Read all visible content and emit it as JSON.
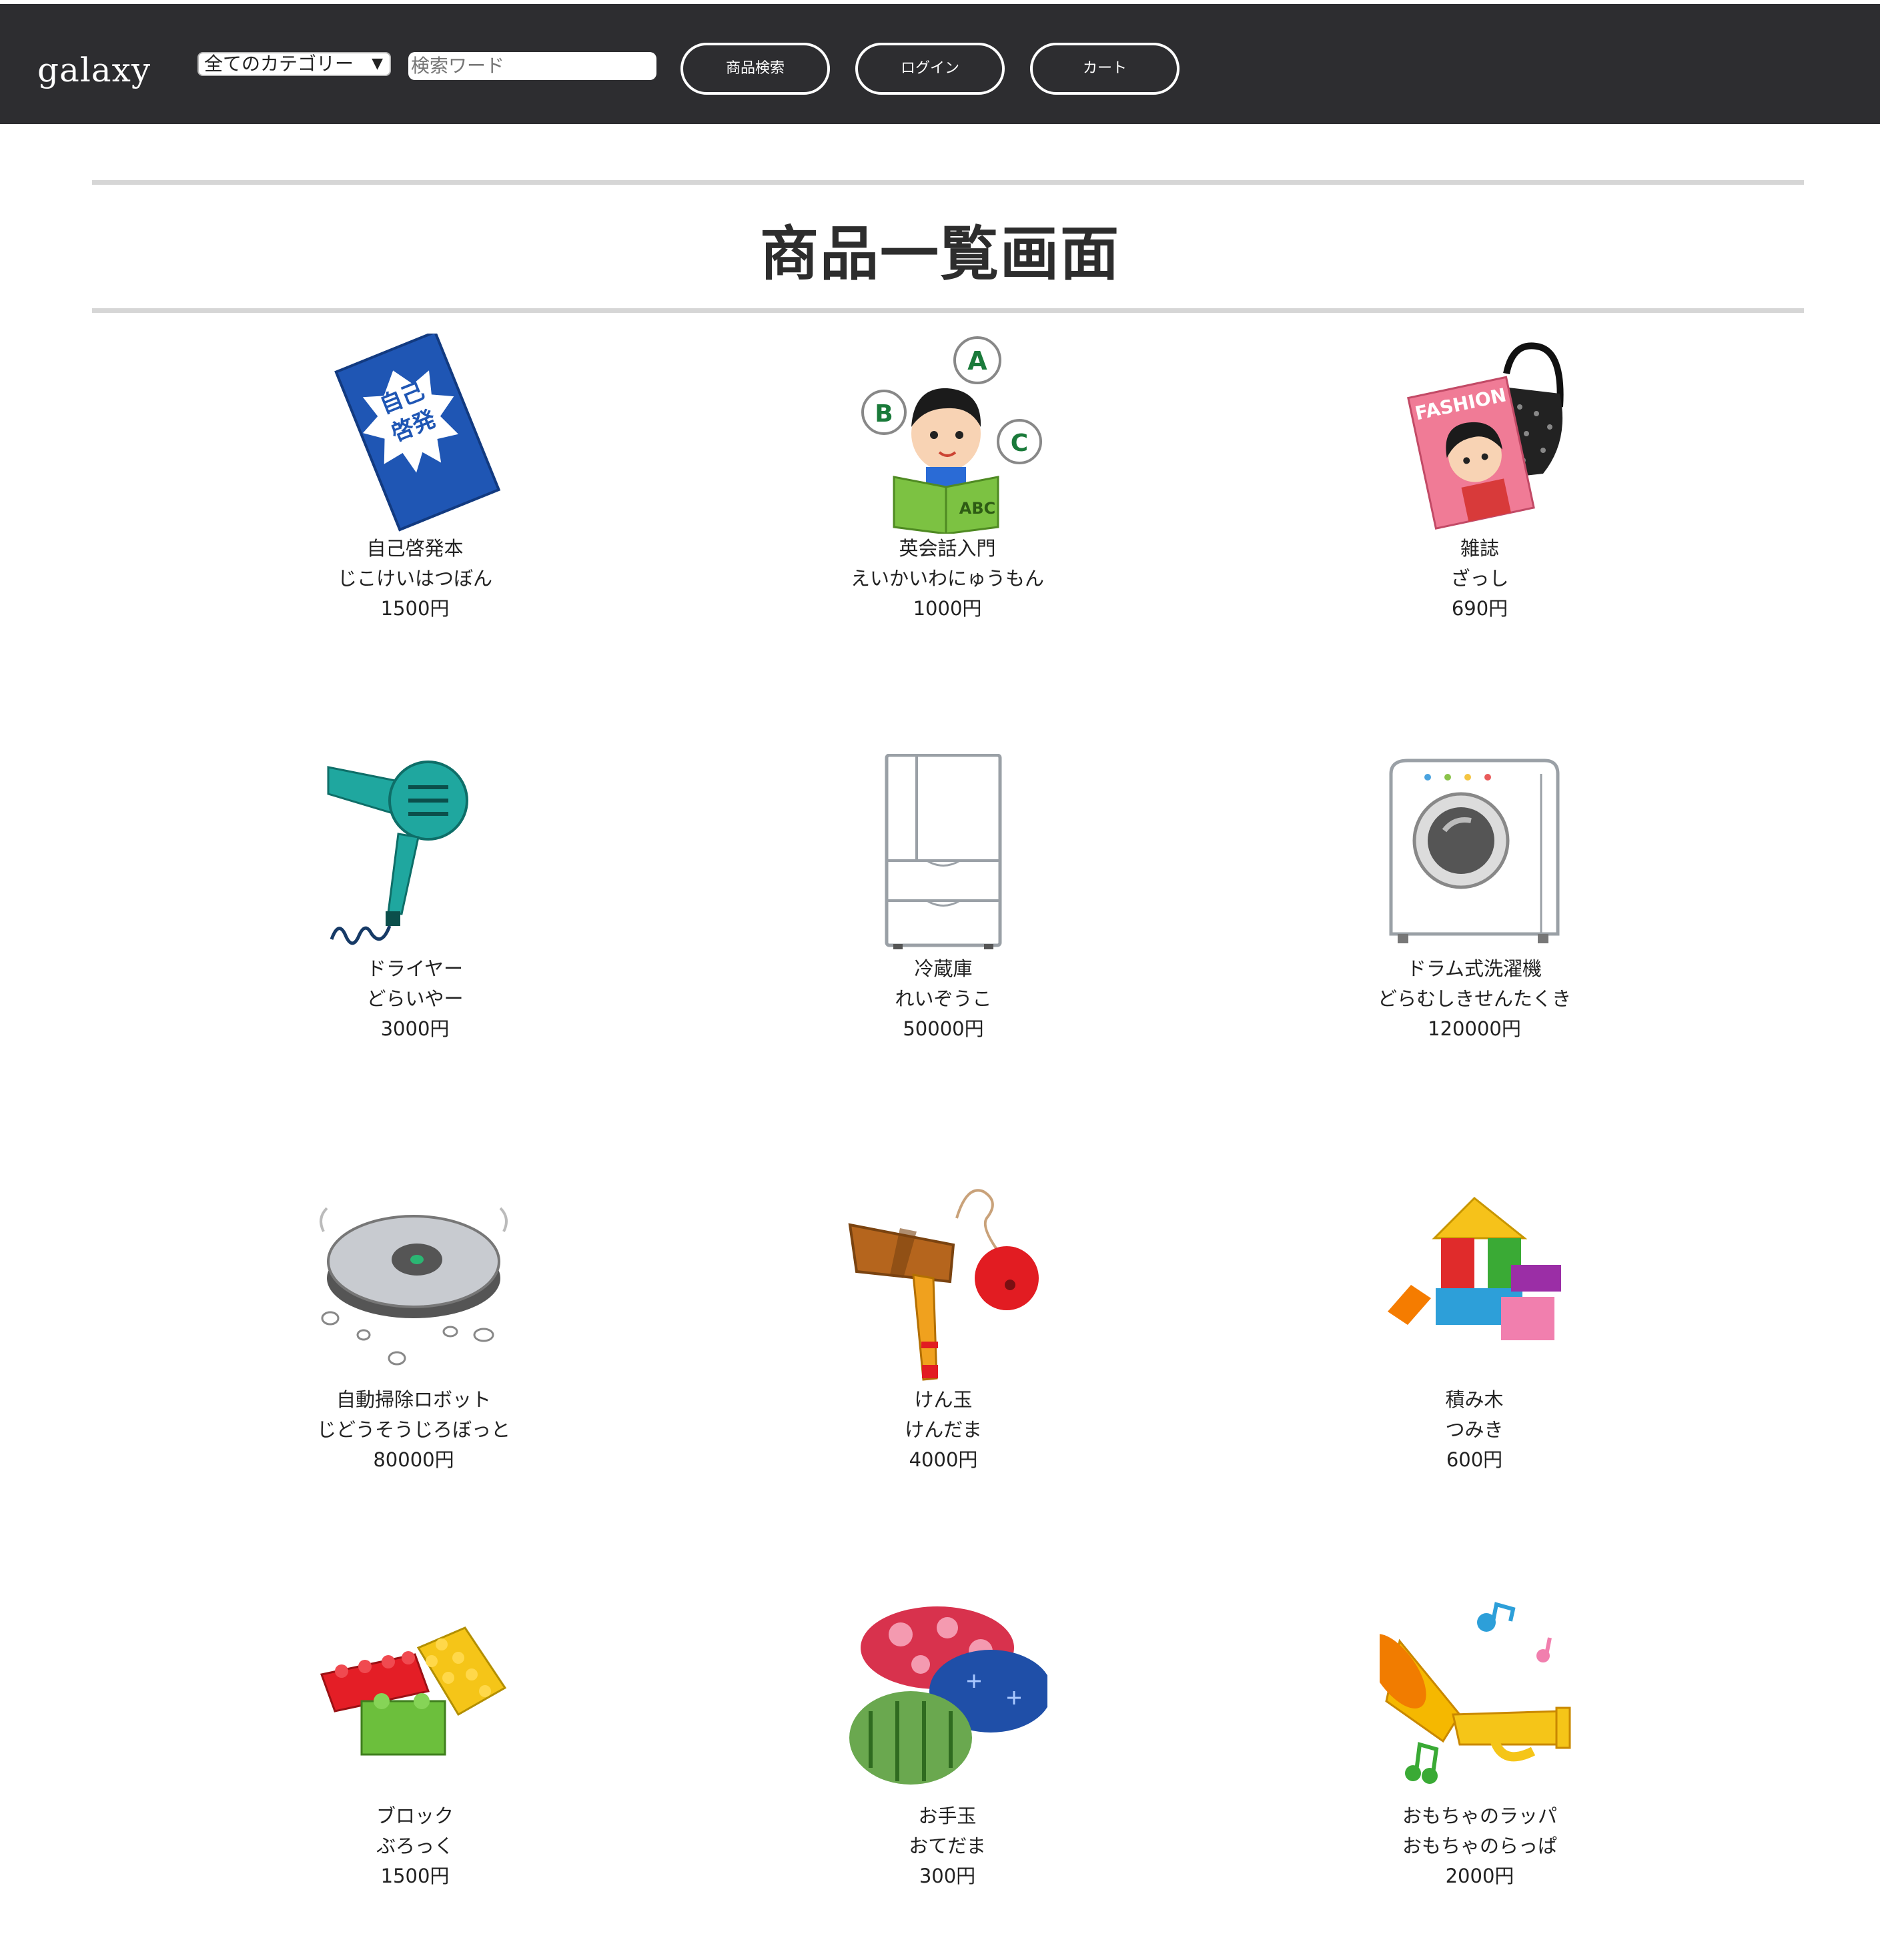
{
  "header": {
    "logo": "galaxy",
    "category_select": "全てのカテゴリー",
    "search_placeholder": "検索ワード",
    "search_button": "商品検索",
    "login_button": "ログイン",
    "cart_button": "カート"
  },
  "page_title": "商品一覧画面",
  "products": [
    {
      "name": "自己啓発本",
      "reading": "じこけいはつぼん",
      "price": "1500円",
      "icon": "self-help-book-icon"
    },
    {
      "name": "英会話入門",
      "reading": "えいかいわにゅうもん",
      "price": "1000円",
      "icon": "english-study-icon"
    },
    {
      "name": "雑誌",
      "reading": "ざっし",
      "price": "690円",
      "icon": "magazine-icon"
    },
    {
      "name": "ドライヤー",
      "reading": "どらいやー",
      "price": "3000円",
      "icon": "hair-dryer-icon"
    },
    {
      "name": "冷蔵庫",
      "reading": "れいぞうこ",
      "price": "50000円",
      "icon": "refrigerator-icon"
    },
    {
      "name": "ドラム式洗濯機",
      "reading": "どらむしきせんたくき",
      "price": "120000円",
      "icon": "washing-machine-icon"
    },
    {
      "name": "自動掃除ロボット",
      "reading": "じどうそうじろぼっと",
      "price": "80000円",
      "icon": "robot-vacuum-icon"
    },
    {
      "name": "けん玉",
      "reading": "けんだま",
      "price": "4000円",
      "icon": "kendama-icon"
    },
    {
      "name": "積み木",
      "reading": "つみき",
      "price": "600円",
      "icon": "building-blocks-icon"
    },
    {
      "name": "ブロック",
      "reading": "ぶろっく",
      "price": "1500円",
      "icon": "toy-bricks-icon"
    },
    {
      "name": "お手玉",
      "reading": "おてだま",
      "price": "300円",
      "icon": "beanbags-icon"
    },
    {
      "name": "おもちゃのラッパ",
      "reading": "おもちゃのらっぱ",
      "price": "2000円",
      "icon": "toy-trumpet-icon"
    }
  ]
}
